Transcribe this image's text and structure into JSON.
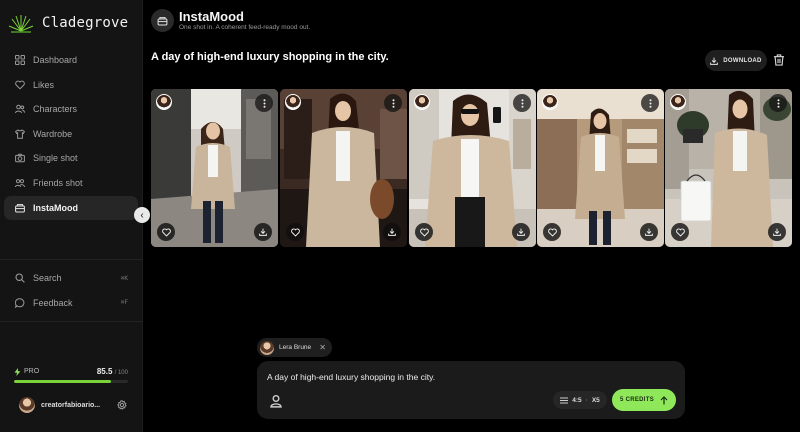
{
  "brand": {
    "name": "Cladegrove"
  },
  "sidebar": {
    "items": [
      {
        "label": "Dashboard",
        "icon": "grid-icon"
      },
      {
        "label": "Likes",
        "icon": "heart-icon"
      },
      {
        "label": "Characters",
        "icon": "users-icon"
      },
      {
        "label": "Wardrobe",
        "icon": "shirt-icon"
      },
      {
        "label": "Single shot",
        "icon": "camera-icon"
      },
      {
        "label": "Friends shot",
        "icon": "group-icon"
      },
      {
        "label": "InstaMood",
        "icon": "folder-icon",
        "active": true
      }
    ],
    "bottom": [
      {
        "label": "Search",
        "kbd": "⌘K",
        "icon": "search-icon"
      },
      {
        "label": "Feedback",
        "kbd": "⌘F",
        "icon": "chat-icon"
      }
    ],
    "plan": {
      "label": "PRO",
      "credits": "85.5",
      "max": "/ 100",
      "progress_fraction": 0.855
    },
    "user": {
      "name": "creatorfabioario..."
    }
  },
  "header": {
    "title": "InstaMood",
    "subtitle": "One shot in. A coherent feed-ready mood out."
  },
  "main": {
    "prompt_title": "A day of high-end luxury shopping in the city.",
    "download_label": "DOWNLOAD",
    "photos": [
      {
        "scene": "street"
      },
      {
        "scene": "boutique-dark"
      },
      {
        "scene": "boutique-white"
      },
      {
        "scene": "mall"
      },
      {
        "scene": "street-bag"
      }
    ]
  },
  "composer": {
    "chip_name": "Lera Brune",
    "text": "A day of high-end luxury shopping in the city.",
    "ratio": "4:5",
    "count": "X5",
    "send_label": "5 CREDITS"
  },
  "colors": {
    "accent": "#8fe85a",
    "progress": "#7bd33a",
    "background": "#000000",
    "sidebar": "#141414"
  }
}
